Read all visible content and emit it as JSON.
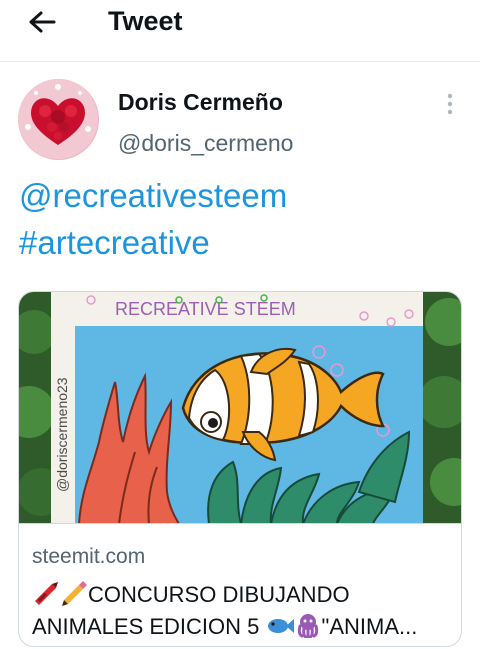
{
  "header": {
    "title": "Tweet",
    "back_icon": "arrow-left-icon"
  },
  "tweet": {
    "author_name": "Doris Cermeño",
    "author_handle": "@doris_cermeno",
    "more_icon": "more-vertical-icon",
    "mention": "@recreativesteem",
    "hashtag": "#artecreative"
  },
  "card": {
    "image_text": "RECREATIVE STEEM",
    "image_signature": "@doriscermeno23",
    "domain": "steemit.com",
    "title_line1": "CONCURSO DIBUJANDO",
    "title_line2_start": "ANIMALES EDICION 5",
    "title_line2_end": "\"ANIMA...",
    "emojis": [
      "crayon-icon",
      "pencil-icon",
      "fish-icon",
      "octopus-icon"
    ]
  },
  "colors": {
    "link": "#1b95e0",
    "secondary_text": "#536471",
    "border": "#cfd9de"
  }
}
